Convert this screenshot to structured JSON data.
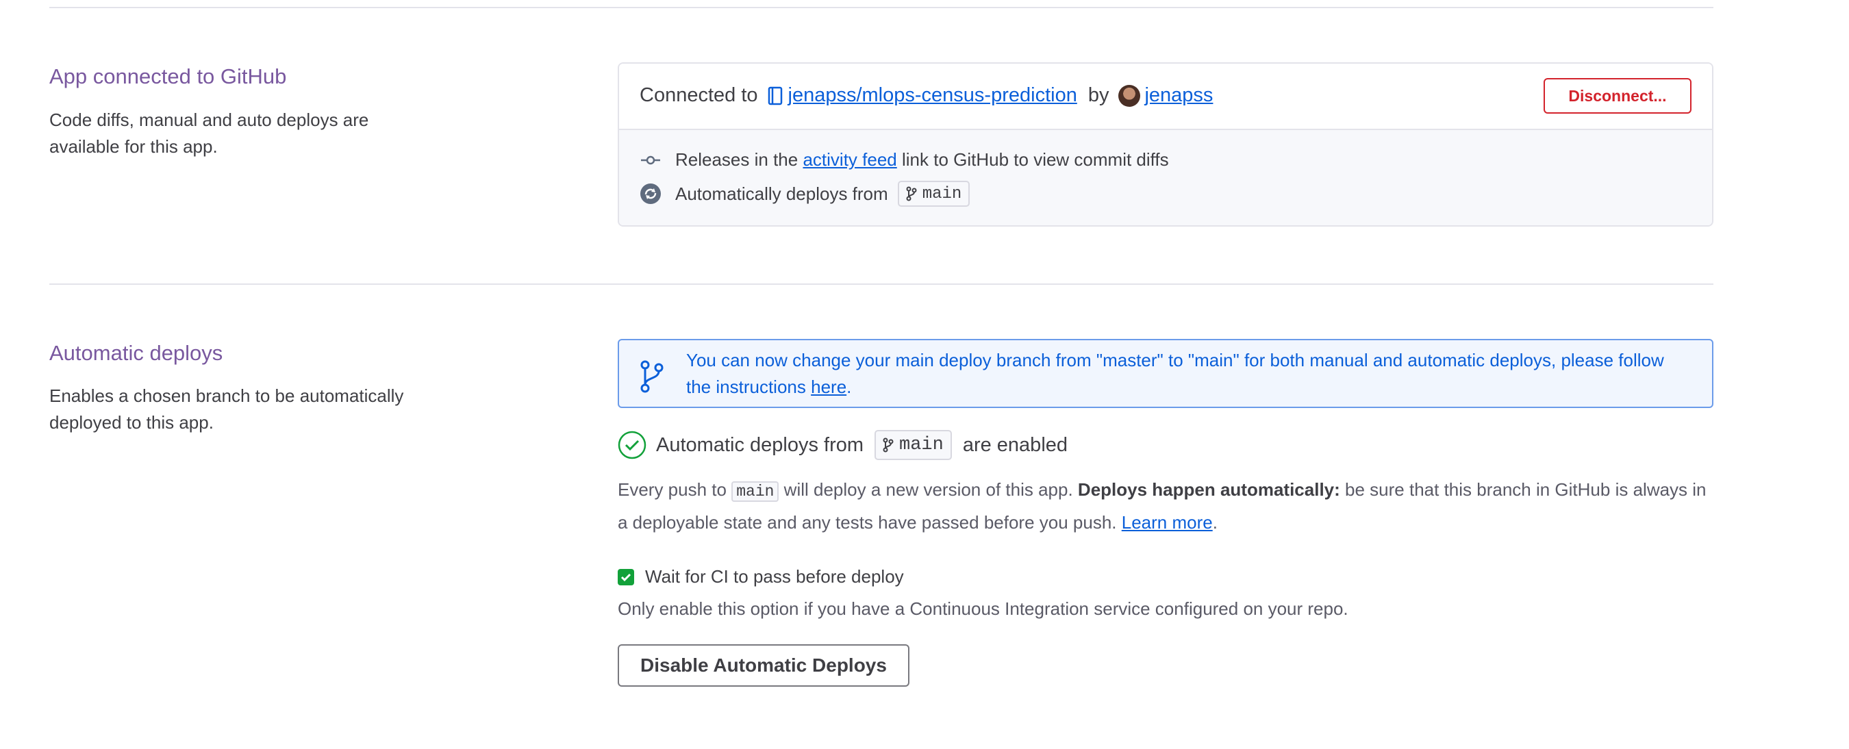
{
  "github_section": {
    "title": "App connected to GitHub",
    "description": "Code diffs, manual and auto deploys are available for this app.",
    "connected_prefix": "Connected to",
    "repo": "jenapss/mlops-census-prediction",
    "by_text": "by",
    "user": "jenapss",
    "disconnect_label": "Disconnect...",
    "releases_prefix": "Releases in the",
    "activity_feed_link": "activity feed",
    "releases_suffix": "link to GitHub to view commit diffs",
    "auto_deploys_text": "Automatically deploys from",
    "branch": "main"
  },
  "auto_deploys_section": {
    "title": "Automatic deploys",
    "description": "Enables a chosen branch to be automatically deployed to this app.",
    "notice_text": "You can now change your main deploy branch from \"master\" to \"main\" for both manual and automatic deploys, please follow the instructions",
    "notice_link": "here",
    "enabled_prefix": "Automatic deploys from",
    "enabled_branch": "main",
    "enabled_suffix": "are enabled",
    "push_prefix": "Every push to",
    "push_branch": "main",
    "push_mid": "will deploy a new version of this app.",
    "push_bold": "Deploys happen automatically:",
    "push_rest": "be sure that this branch in GitHub is always in a deployable state and any tests have passed before you push.",
    "learn_more": "Learn more",
    "ci_label": "Wait for CI to pass before deploy",
    "ci_checked": true,
    "ci_help": "Only enable this option if you have a Continuous Integration service configured on your repo.",
    "disable_label": "Disable Automatic Deploys"
  },
  "colors": {
    "section_title": "#79589f",
    "link": "#0b5fd9",
    "danger": "#d3232c",
    "success": "#12a13a",
    "notice_border": "#6b9bea"
  }
}
